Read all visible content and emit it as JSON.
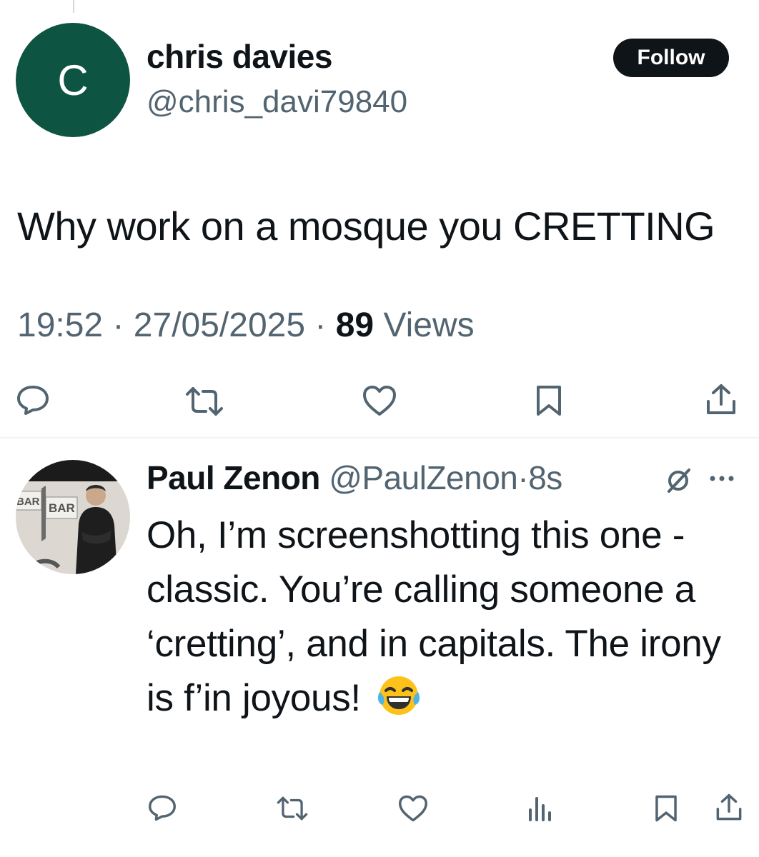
{
  "tweet": {
    "avatar_initial": "C",
    "author_name": "chris davies",
    "author_handle": "@chris_davi79840",
    "follow_label": "Follow",
    "text": "Why work on a mosque you CRETTING",
    "time": "19:52",
    "separator": "·",
    "date": "27/05/2025",
    "views_count": "89",
    "views_label": "Views"
  },
  "reply": {
    "author_name": "Paul Zenon",
    "author_handle": "@PaulZenon",
    "separator": "·",
    "time": "8s",
    "avatar_sign_1": "BAR",
    "avatar_sign_2": "BAR",
    "text": "Oh, I’m screenshotting this one - classic. You’re calling someone a ‘cretting’, and in capitals. The irony is f’in joyous!",
    "emoji": "face-with-tears-of-joy"
  },
  "icons": {
    "reply": "comment-icon",
    "repost": "repost-icon",
    "like": "heart-icon",
    "bookmark": "bookmark-icon",
    "share": "share-icon",
    "analytics": "analytics-icon",
    "grok": "grok-icon",
    "more": "more-icon"
  },
  "colors": {
    "avatar_bg": "#0e5443",
    "text_primary": "#0f1419",
    "text_secondary": "#536471",
    "follow_bg": "#0f1419"
  }
}
